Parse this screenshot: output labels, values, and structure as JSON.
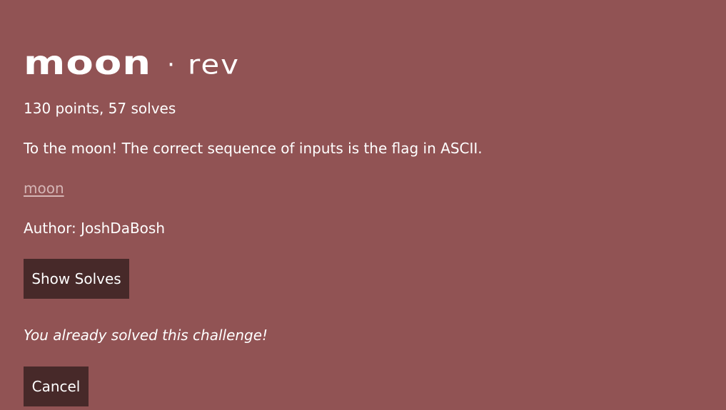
{
  "challenge": {
    "name": "moon",
    "separator": "·",
    "category": "rev",
    "meta": "130 points, 57 solves",
    "description": "To the moon! The correct sequence of inputs is the flag in ASCII.",
    "file_link": "moon",
    "author": "Author: JoshDaBosh"
  },
  "buttons": {
    "show_solves": "Show Solves",
    "cancel": "Cancel"
  },
  "status": {
    "solved_message": "You already solved this challenge!"
  },
  "colors": {
    "background": "#915354",
    "button": "#472929",
    "link": "#d5b6b6"
  }
}
